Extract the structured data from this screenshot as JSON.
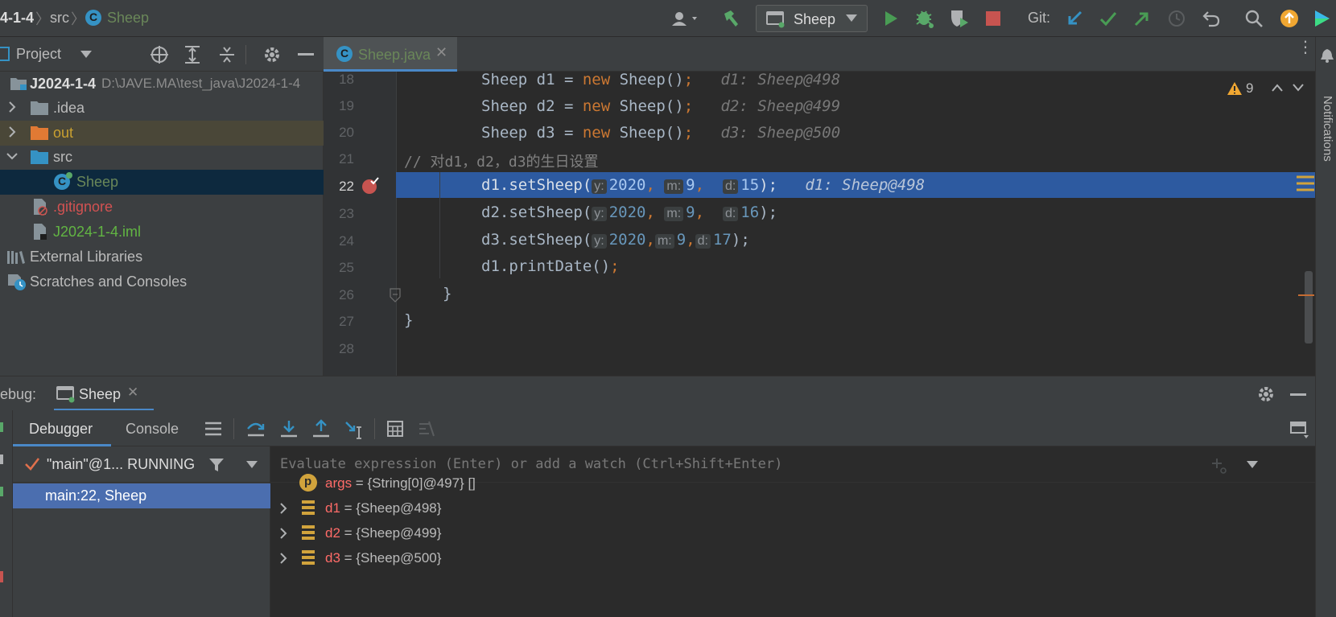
{
  "breadcrumb": [
    "4-1-4",
    "src",
    "Sheep"
  ],
  "toolbar": {
    "run_config": "Sheep",
    "git_label": "Git:"
  },
  "project_panel": {
    "title": "Project",
    "tree": [
      {
        "label": "J2024-1-4",
        "path": "D:\\JAVE.MA\\test_java\\J2024-1-4"
      },
      {
        "label": ".idea"
      },
      {
        "label": "out"
      },
      {
        "label": "src"
      },
      {
        "label": "Sheep"
      },
      {
        "label": ".gitignore"
      },
      {
        "label": "J2024-1-4.iml"
      },
      {
        "label": "External Libraries"
      },
      {
        "label": "Scratches and Consoles"
      }
    ]
  },
  "editor": {
    "tab": "Sheep.java",
    "warnings": "9",
    "line_numbers": [
      "18",
      "19",
      "20",
      "21",
      "22",
      "23",
      "24",
      "25",
      "26",
      "27",
      "28"
    ],
    "lines": {
      "l18": {
        "code_a": "Sheep d1 = ",
        "kw": "new",
        "code_b": " Sheep()",
        "semi": ";",
        "hint": "d1: Sheep@498"
      },
      "l19": {
        "code_a": "Sheep d2 = ",
        "kw": "new",
        "code_b": " Sheep()",
        "semi": ";",
        "hint": "d2: Sheep@499"
      },
      "l20": {
        "code_a": "Sheep d3 = ",
        "kw": "new",
        "code_b": " Sheep()",
        "semi": ";",
        "hint": "d3: Sheep@500"
      },
      "l21": {
        "comment": "// 对d1，d2，d3的生日设置"
      },
      "l22": {
        "call": "d1.setSheep(",
        "y": "2020",
        "m": "9",
        "d": "15",
        "end": ");",
        "semi": ";",
        "hint": "d1: Sheep@498"
      },
      "l23": {
        "call": "d2.setSheep(",
        "y": "2020",
        "m": "9",
        "d": "16",
        "end": ");",
        "semi": ";"
      },
      "l24": {
        "call": "d3.setSheep(",
        "y": "2020",
        "m": "9",
        "d": "17",
        "end": ");",
        "semi": ";"
      },
      "l25": {
        "call": "d1.printDate()",
        "semi": ";"
      },
      "l26": {
        "brace": "}"
      },
      "l27": {
        "brace": "}"
      }
    },
    "param_hints": {
      "y": "y:",
      "m": "m:",
      "d": "d:"
    }
  },
  "debug": {
    "label": "ebug:",
    "session_tab": "Sheep",
    "tabs": [
      "Debugger",
      "Console"
    ],
    "thread": "\"main\"@1... RUNNING",
    "frame": "main:22, Sheep",
    "eval_placeholder": "Evaluate expression (Enter) or add a watch (Ctrl+Shift+Enter)",
    "variables": [
      {
        "name": "args",
        "value": "{String[0]@497} []"
      },
      {
        "name": "d1",
        "value": "{Sheep@498}"
      },
      {
        "name": "d2",
        "value": "{Sheep@499}"
      },
      {
        "name": "d3",
        "value": "{Sheep@500}"
      }
    ]
  },
  "right_strip": {
    "label": "Notifications"
  }
}
